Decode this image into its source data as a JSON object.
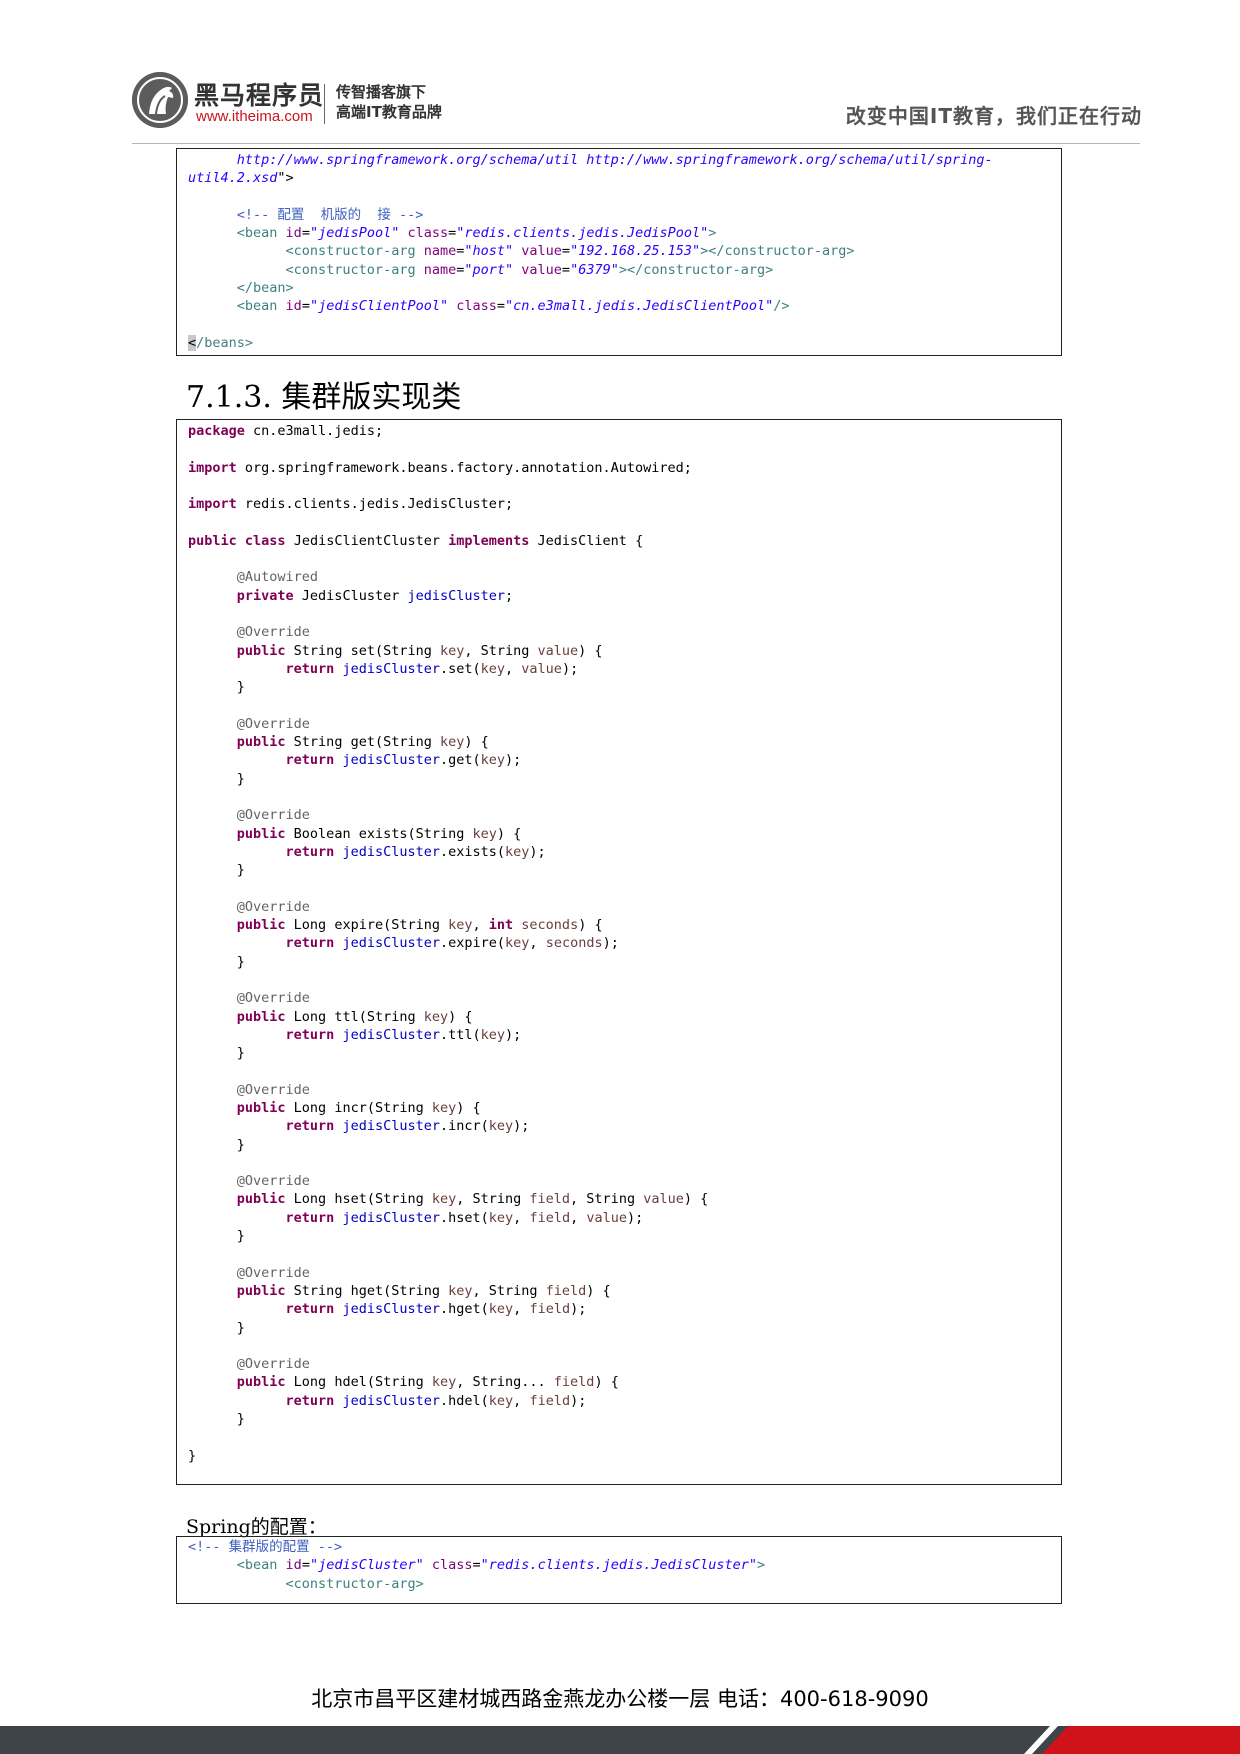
{
  "header": {
    "brand_name": "黑马程序员",
    "brand_url": "www.itheima.com",
    "brand_tagline": "传智播客旗下\n高端IT教育品牌",
    "slogan": "改变中国IT教育，我们正在行动"
  },
  "box1": {
    "lines": [
      [
        [
          "val",
          "      http://www.springframework.org/schema/util http://www.springframework.org/schema/util/spring-"
        ]
      ],
      [
        [
          "val",
          "util4.2.xsd"
        ],
        [
          "pln",
          "\">"
        ]
      ],
      [
        [
          "pln",
          ""
        ]
      ],
      [
        [
          "cmt",
          "      <!-- 配置  机版的  接 -->"
        ]
      ],
      [
        [
          "tag",
          "      <bean "
        ],
        [
          "attr",
          "id"
        ],
        [
          "pln",
          "="
        ],
        [
          "val",
          "\"jedisPool\""
        ],
        [
          "pln",
          " "
        ],
        [
          "attr",
          "class"
        ],
        [
          "pln",
          "="
        ],
        [
          "val",
          "\"redis.clients.jedis.JedisPool\""
        ],
        [
          "tag",
          ">"
        ]
      ],
      [
        [
          "tag",
          "            <constructor-arg "
        ],
        [
          "attr",
          "name"
        ],
        [
          "pln",
          "="
        ],
        [
          "val",
          "\"host\""
        ],
        [
          "pln",
          " "
        ],
        [
          "attr",
          "value"
        ],
        [
          "pln",
          "="
        ],
        [
          "val",
          "\"192.168.25.153\""
        ],
        [
          "tag",
          "></constructor-arg>"
        ]
      ],
      [
        [
          "tag",
          "            <constructor-arg "
        ],
        [
          "attr",
          "name"
        ],
        [
          "pln",
          "="
        ],
        [
          "val",
          "\"port\""
        ],
        [
          "pln",
          " "
        ],
        [
          "attr",
          "value"
        ],
        [
          "pln",
          "="
        ],
        [
          "val",
          "\"6379\""
        ],
        [
          "tag",
          "></constructor-arg>"
        ]
      ],
      [
        [
          "tag",
          "      </bean>"
        ]
      ],
      [
        [
          "tag",
          "      <bean "
        ],
        [
          "attr",
          "id"
        ],
        [
          "pln",
          "="
        ],
        [
          "val",
          "\"jedisClientPool\""
        ],
        [
          "pln",
          " "
        ],
        [
          "attr",
          "class"
        ],
        [
          "pln",
          "="
        ],
        [
          "val",
          "\"cn.e3mall.jedis.JedisClientPool\""
        ],
        [
          "tag",
          "/>"
        ]
      ],
      [
        [
          "pln",
          ""
        ]
      ],
      [
        [
          "hl",
          "<"
        ],
        [
          "tag",
          "/beans>"
        ]
      ]
    ]
  },
  "section_title": "7.1.3. 集群版实现类",
  "box2": {
    "lines": [
      [
        [
          "kw",
          "package"
        ],
        [
          "pln",
          " cn.e3mall.jedis;"
        ]
      ],
      [
        [
          "pln",
          ""
        ]
      ],
      [
        [
          "kw",
          "import"
        ],
        [
          "pln",
          " org.springframework.beans.factory.annotation.Autowired;"
        ]
      ],
      [
        [
          "pln",
          ""
        ]
      ],
      [
        [
          "kw",
          "import"
        ],
        [
          "pln",
          " redis.clients.jedis.JedisCluster;"
        ]
      ],
      [
        [
          "pln",
          ""
        ]
      ],
      [
        [
          "kw",
          "public"
        ],
        [
          "pln",
          " "
        ],
        [
          "kw",
          "class"
        ],
        [
          "pln",
          " JedisClientCluster "
        ],
        [
          "kw",
          "implements"
        ],
        [
          "pln",
          " JedisClient {"
        ]
      ],
      [
        [
          "pln",
          ""
        ]
      ],
      [
        [
          "ann",
          "      @Autowired"
        ]
      ],
      [
        [
          "kw",
          "      private"
        ],
        [
          "pln",
          " JedisCluster "
        ],
        [
          "fld",
          "jedisCluster"
        ],
        [
          "pln",
          ";"
        ]
      ],
      [
        [
          "pln",
          ""
        ]
      ],
      [
        [
          "ann",
          "      @Override"
        ]
      ],
      [
        [
          "kw",
          "      public"
        ],
        [
          "pln",
          " String set(String "
        ],
        [
          "var",
          "key"
        ],
        [
          "pln",
          ", String "
        ],
        [
          "var",
          "value"
        ],
        [
          "pln",
          ") {"
        ]
      ],
      [
        [
          "kw",
          "            return"
        ],
        [
          "pln",
          " "
        ],
        [
          "fld",
          "jedisCluster"
        ],
        [
          "pln",
          ".set("
        ],
        [
          "var",
          "key"
        ],
        [
          "pln",
          ", "
        ],
        [
          "var",
          "value"
        ],
        [
          "pln",
          ");"
        ]
      ],
      [
        [
          "pln",
          "      }"
        ]
      ],
      [
        [
          "pln",
          ""
        ]
      ],
      [
        [
          "ann",
          "      @Override"
        ]
      ],
      [
        [
          "kw",
          "      public"
        ],
        [
          "pln",
          " String get(String "
        ],
        [
          "var",
          "key"
        ],
        [
          "pln",
          ") {"
        ]
      ],
      [
        [
          "kw",
          "            return"
        ],
        [
          "pln",
          " "
        ],
        [
          "fld",
          "jedisCluster"
        ],
        [
          "pln",
          ".get("
        ],
        [
          "var",
          "key"
        ],
        [
          "pln",
          ");"
        ]
      ],
      [
        [
          "pln",
          "      }"
        ]
      ],
      [
        [
          "pln",
          ""
        ]
      ],
      [
        [
          "ann",
          "      @Override"
        ]
      ],
      [
        [
          "kw",
          "      public"
        ],
        [
          "pln",
          " Boolean exists(String "
        ],
        [
          "var",
          "key"
        ],
        [
          "pln",
          ") {"
        ]
      ],
      [
        [
          "kw",
          "            return"
        ],
        [
          "pln",
          " "
        ],
        [
          "fld",
          "jedisCluster"
        ],
        [
          "pln",
          ".exists("
        ],
        [
          "var",
          "key"
        ],
        [
          "pln",
          ");"
        ]
      ],
      [
        [
          "pln",
          "      }"
        ]
      ],
      [
        [
          "pln",
          ""
        ]
      ],
      [
        [
          "ann",
          "      @Override"
        ]
      ],
      [
        [
          "kw",
          "      public"
        ],
        [
          "pln",
          " Long expire(String "
        ],
        [
          "var",
          "key"
        ],
        [
          "pln",
          ", "
        ],
        [
          "kw",
          "int"
        ],
        [
          "pln",
          " "
        ],
        [
          "var",
          "seconds"
        ],
        [
          "pln",
          ") {"
        ]
      ],
      [
        [
          "kw",
          "            return"
        ],
        [
          "pln",
          " "
        ],
        [
          "fld",
          "jedisCluster"
        ],
        [
          "pln",
          ".expire("
        ],
        [
          "var",
          "key"
        ],
        [
          "pln",
          ", "
        ],
        [
          "var",
          "seconds"
        ],
        [
          "pln",
          ");"
        ]
      ],
      [
        [
          "pln",
          "      }"
        ]
      ],
      [
        [
          "pln",
          ""
        ]
      ],
      [
        [
          "ann",
          "      @Override"
        ]
      ],
      [
        [
          "kw",
          "      public"
        ],
        [
          "pln",
          " Long ttl(String "
        ],
        [
          "var",
          "key"
        ],
        [
          "pln",
          ") {"
        ]
      ],
      [
        [
          "kw",
          "            return"
        ],
        [
          "pln",
          " "
        ],
        [
          "fld",
          "jedisCluster"
        ],
        [
          "pln",
          ".ttl("
        ],
        [
          "var",
          "key"
        ],
        [
          "pln",
          ");"
        ]
      ],
      [
        [
          "pln",
          "      }"
        ]
      ],
      [
        [
          "pln",
          ""
        ]
      ],
      [
        [
          "ann",
          "      @Override"
        ]
      ],
      [
        [
          "kw",
          "      public"
        ],
        [
          "pln",
          " Long incr(String "
        ],
        [
          "var",
          "key"
        ],
        [
          "pln",
          ") {"
        ]
      ],
      [
        [
          "kw",
          "            return"
        ],
        [
          "pln",
          " "
        ],
        [
          "fld",
          "jedisCluster"
        ],
        [
          "pln",
          ".incr("
        ],
        [
          "var",
          "key"
        ],
        [
          "pln",
          ");"
        ]
      ],
      [
        [
          "pln",
          "      }"
        ]
      ],
      [
        [
          "pln",
          ""
        ]
      ],
      [
        [
          "ann",
          "      @Override"
        ]
      ],
      [
        [
          "kw",
          "      public"
        ],
        [
          "pln",
          " Long hset(String "
        ],
        [
          "var",
          "key"
        ],
        [
          "pln",
          ", String "
        ],
        [
          "var",
          "field"
        ],
        [
          "pln",
          ", String "
        ],
        [
          "var",
          "value"
        ],
        [
          "pln",
          ") {"
        ]
      ],
      [
        [
          "kw",
          "            return"
        ],
        [
          "pln",
          " "
        ],
        [
          "fld",
          "jedisCluster"
        ],
        [
          "pln",
          ".hset("
        ],
        [
          "var",
          "key"
        ],
        [
          "pln",
          ", "
        ],
        [
          "var",
          "field"
        ],
        [
          "pln",
          ", "
        ],
        [
          "var",
          "value"
        ],
        [
          "pln",
          ");"
        ]
      ],
      [
        [
          "pln",
          "      }"
        ]
      ],
      [
        [
          "pln",
          ""
        ]
      ],
      [
        [
          "ann",
          "      @Override"
        ]
      ],
      [
        [
          "kw",
          "      public"
        ],
        [
          "pln",
          " String hget(String "
        ],
        [
          "var",
          "key"
        ],
        [
          "pln",
          ", String "
        ],
        [
          "var",
          "field"
        ],
        [
          "pln",
          ") {"
        ]
      ],
      [
        [
          "kw",
          "            return"
        ],
        [
          "pln",
          " "
        ],
        [
          "fld",
          "jedisCluster"
        ],
        [
          "pln",
          ".hget("
        ],
        [
          "var",
          "key"
        ],
        [
          "pln",
          ", "
        ],
        [
          "var",
          "field"
        ],
        [
          "pln",
          ");"
        ]
      ],
      [
        [
          "pln",
          "      }"
        ]
      ],
      [
        [
          "pln",
          ""
        ]
      ],
      [
        [
          "ann",
          "      @Override"
        ]
      ],
      [
        [
          "kw",
          "      public"
        ],
        [
          "pln",
          " Long hdel(String "
        ],
        [
          "var",
          "key"
        ],
        [
          "pln",
          ", String... "
        ],
        [
          "var",
          "field"
        ],
        [
          "pln",
          ") {"
        ]
      ],
      [
        [
          "kw",
          "            return"
        ],
        [
          "pln",
          " "
        ],
        [
          "fld",
          "jedisCluster"
        ],
        [
          "pln",
          ".hdel("
        ],
        [
          "var",
          "key"
        ],
        [
          "pln",
          ", "
        ],
        [
          "var",
          "field"
        ],
        [
          "pln",
          ");"
        ]
      ],
      [
        [
          "pln",
          "      }"
        ]
      ],
      [
        [
          "pln",
          ""
        ]
      ],
      [
        [
          "pln",
          "}"
        ]
      ]
    ]
  },
  "paragraph": "Spring的配置：",
  "box3": {
    "lines": [
      [
        [
          "cmt",
          "<!-- 集群版的配置 -->"
        ]
      ],
      [
        [
          "tag",
          "      <bean "
        ],
        [
          "attr",
          "id"
        ],
        [
          "pln",
          "="
        ],
        [
          "val",
          "\"jedisCluster\""
        ],
        [
          "pln",
          " "
        ],
        [
          "attr",
          "class"
        ],
        [
          "pln",
          "="
        ],
        [
          "val",
          "\"redis.clients.jedis.JedisCluster\""
        ],
        [
          "tag",
          ">"
        ]
      ],
      [
        [
          "tag",
          "            <constructor-arg>"
        ]
      ]
    ]
  },
  "footer": {
    "address": "北京市昌平区建材城西路金燕龙办公楼一层   电话：400-618-9090"
  }
}
